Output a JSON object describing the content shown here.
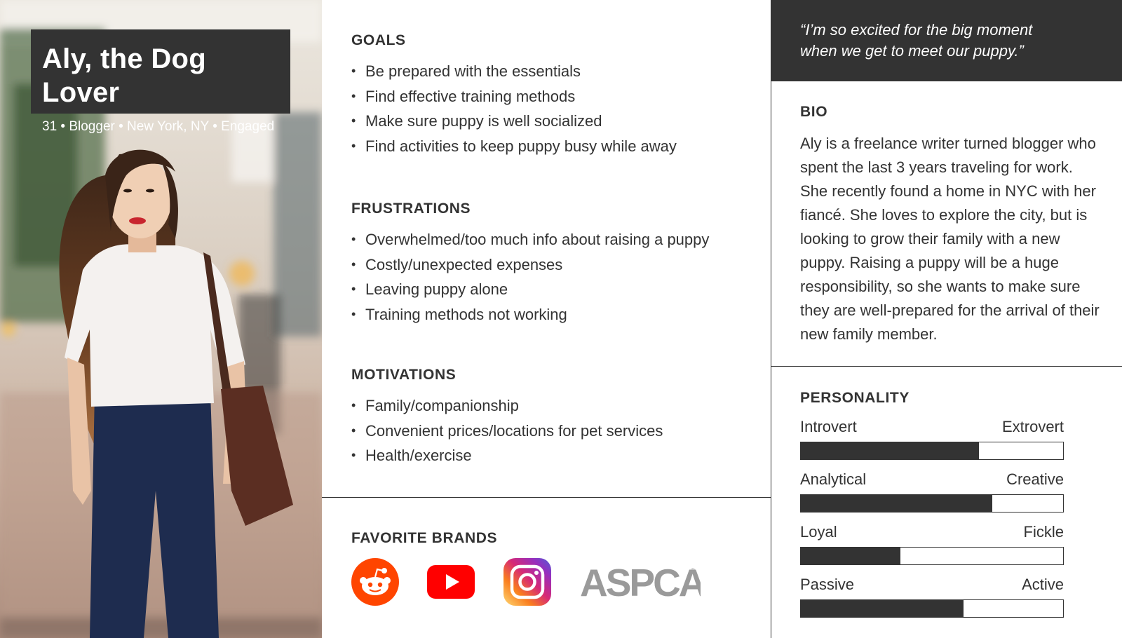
{
  "persona": {
    "name": "Aly, the Dog Lover",
    "subtitle": "31 • Blogger • New York, NY • Engaged"
  },
  "goals": {
    "title": "GOALS",
    "items": [
      "Be prepared with the essentials",
      "Find effective training methods",
      "Make sure puppy is well socialized",
      "Find activities to keep puppy busy while away"
    ]
  },
  "frustrations": {
    "title": "FRUSTRATIONS",
    "items": [
      "Overwhelmed/too much info about raising a puppy",
      "Costly/unexpected expenses",
      "Leaving puppy alone",
      "Training methods not working"
    ]
  },
  "motivations": {
    "title": "MOTIVATIONS",
    "items": [
      "Family/companionship",
      "Convenient prices/locations for pet services",
      "Health/exercise"
    ]
  },
  "brands": {
    "title": "FAVORITE BRANDS",
    "logos": [
      {
        "icon": "reddit-icon",
        "color": "#ff4500"
      },
      {
        "icon": "youtube-icon",
        "color": "#ff0000"
      },
      {
        "icon": "instagram-icon",
        "color": "#c13584"
      },
      {
        "icon": "aspca-logo",
        "color": "#9a9a9a",
        "text": "ASPCA"
      }
    ]
  },
  "quote": {
    "line1": "“I’m so excited for the big moment",
    "line2": "when we get to meet our puppy.”"
  },
  "bio": {
    "title": "BIO",
    "text": "Aly is a freelance writer turned blogger who spent the last 3 years traveling for work. She recently found a home in NYC with her fiancé. She loves to explore the city, but is looking to grow their family with a new puppy. Raising a puppy will be a huge responsibility, so she wants to make sure they are well-prepared for the arrival of their new family member."
  },
  "personality": {
    "title": "PERSONALITY",
    "traits": [
      {
        "left": "Introvert",
        "right": "Extrovert",
        "value": 0.68
      },
      {
        "left": "Analytical",
        "right": "Creative",
        "value": 0.73
      },
      {
        "left": "Loyal",
        "right": "Fickle",
        "value": 0.38
      },
      {
        "left": "Passive",
        "right": "Active",
        "value": 0.62
      }
    ]
  },
  "colors": {
    "dark": "#333333",
    "white": "#ffffff"
  }
}
